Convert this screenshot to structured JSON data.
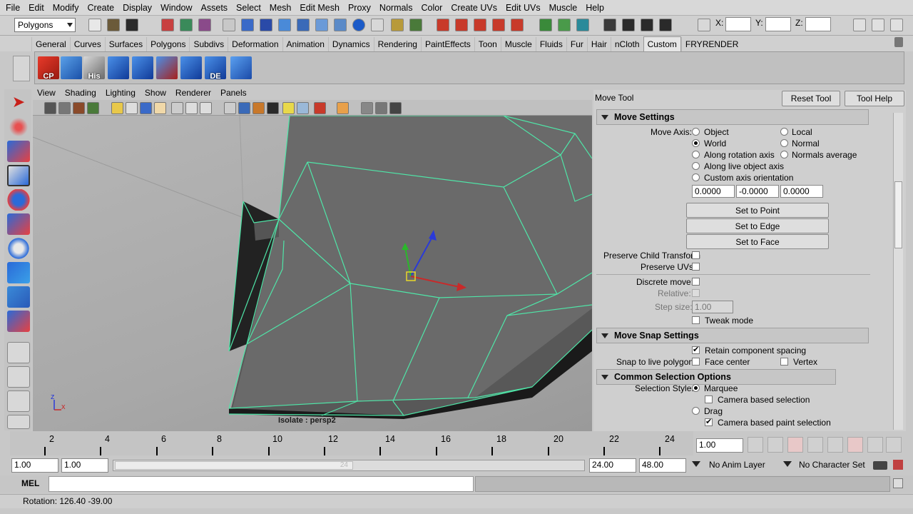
{
  "menubar": {
    "items": [
      "File",
      "Edit",
      "Modify",
      "Create",
      "Display",
      "Window",
      "Assets",
      "Select",
      "Mesh",
      "Edit Mesh",
      "Proxy",
      "Normals",
      "Color",
      "Create UVs",
      "Edit UVs",
      "Muscle",
      "Help"
    ]
  },
  "statusline": {
    "menuset": "Polygons",
    "x_label": "X:",
    "y_label": "Y:",
    "z_label": "Z:"
  },
  "shelf": {
    "tabs": [
      "General",
      "Curves",
      "Surfaces",
      "Polygons",
      "Subdivs",
      "Deformation",
      "Animation",
      "Dynamics",
      "Rendering",
      "PaintEffects",
      "Toon",
      "Muscle",
      "Fluids",
      "Fur",
      "Hair",
      "nCloth",
      "Custom",
      "FRYRENDER"
    ],
    "active_tab": "Custom",
    "icon_labels": [
      "CP",
      "",
      "His",
      "",
      "",
      "",
      "",
      "DE",
      ""
    ]
  },
  "viewport": {
    "menu": [
      "View",
      "Shading",
      "Lighting",
      "Show",
      "Renderer",
      "Panels"
    ],
    "isolate_label": "Isolate : persp2",
    "axis_z": "z",
    "axis_x": "x"
  },
  "tool_settings": {
    "title": "Move Tool",
    "reset_button": "Reset Tool",
    "help_button": "Tool Help",
    "move_settings": {
      "header": "Move Settings",
      "move_axis_label": "Move Axis:",
      "options": [
        "Object",
        "Local",
        "World",
        "Normal",
        "Along rotation axis",
        "Normals average",
        "Along live object axis",
        "Custom axis orientation"
      ],
      "selected": "World",
      "vector": [
        "0.0000",
        "-0.0000",
        "0.0000"
      ],
      "set_to_point": "Set to Point",
      "set_to_edge": "Set to Edge",
      "set_to_face": "Set to Face",
      "preserve_child": "Preserve Child Transform",
      "preserve_uvs": "Preserve UVs",
      "discrete_move": "Discrete move:",
      "relative": "Relative:",
      "step_size_label": "Step size:",
      "step_size": "1.00",
      "tweak_mode": "Tweak mode"
    },
    "snap_settings": {
      "header": "Move Snap Settings",
      "retain": "Retain component spacing",
      "snap_live_label": "Snap to live polygon:",
      "face_center": "Face center",
      "vertex": "Vertex"
    },
    "selection_options": {
      "header": "Common Selection Options",
      "style_label": "Selection Style:",
      "marquee": "Marquee",
      "camera_based": "Camera based selection",
      "drag": "Drag",
      "camera_paint": "Camera based paint selection"
    }
  },
  "timeline": {
    "ticks": [
      "2",
      "4",
      "6",
      "8",
      "10",
      "12",
      "14",
      "16",
      "18",
      "20",
      "22",
      "24"
    ],
    "current_frame": "1.00"
  },
  "range": {
    "start": "1.00",
    "inner_start": "1.00",
    "range_label": "24",
    "inner_end": "24.00",
    "end": "48.00",
    "anim_layer": "No Anim Layer",
    "char_set": "No Character Set"
  },
  "command": {
    "mel_label": "MEL"
  },
  "help_line": {
    "text": "Rotation:  126.40  -39.00"
  },
  "colors": {
    "wire": "#4fe6a8",
    "panel": "#cfcfcf",
    "menubar": "#d8d8d8"
  }
}
